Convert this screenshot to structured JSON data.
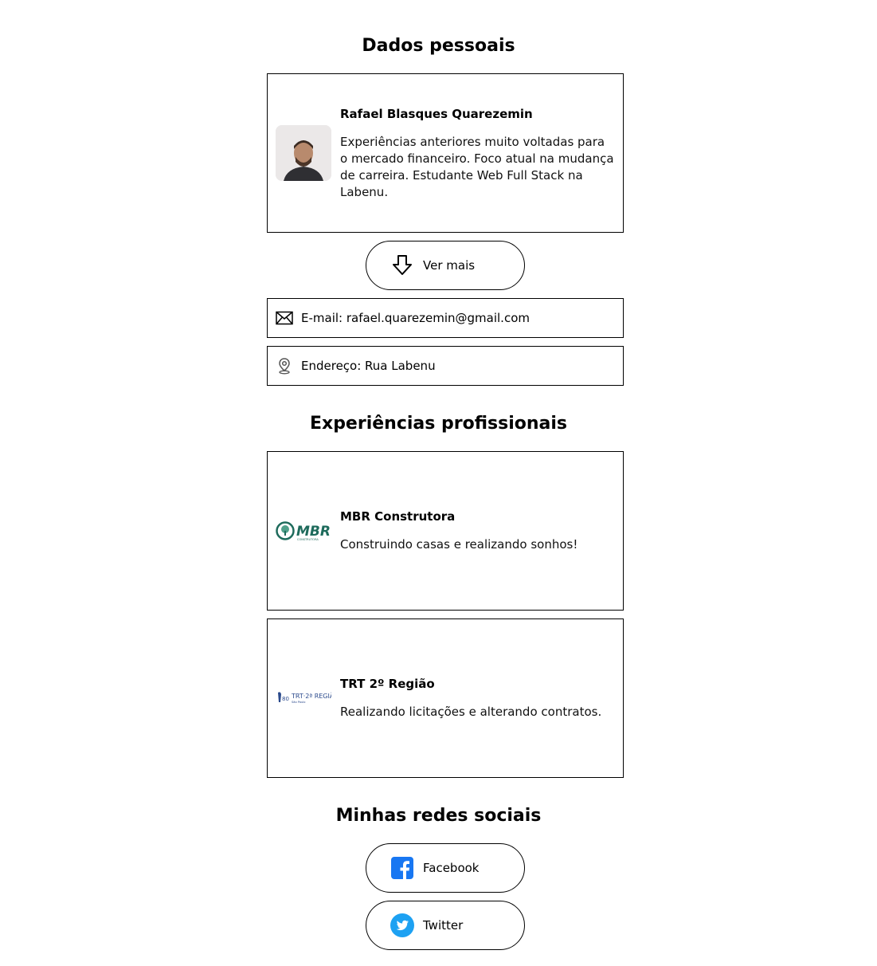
{
  "personal": {
    "title": "Dados pessoais",
    "name": "Rafael Blasques Quarezemin",
    "description": "Experiências anteriores muito voltadas para o mercado financeiro. Foco atual na mudança de carreira. Estudante Web Full Stack na Labenu.",
    "see_more_label": "Ver mais",
    "email_text": "E-mail: rafael.quarezemin@gmail.com",
    "address_text": "Endereço: Rua Labenu"
  },
  "experience": {
    "title": "Experiências profissionais",
    "items": [
      {
        "company": "MBR Construtora",
        "description": "Construindo casas e realizando sonhos!",
        "logo_text": "MBR",
        "logo_sub": "CONSTRUTORA"
      },
      {
        "company": "TRT 2º Região",
        "description": "Realizando licitações e alterando contratos.",
        "logo_text": "TRT·2ª REGIÃO",
        "logo_sub": "São Paulo"
      }
    ]
  },
  "social": {
    "title": "Minhas redes sociais",
    "facebook_label": "Facebook",
    "twitter_label": "Twitter"
  },
  "colors": {
    "facebook": "#1877f2",
    "twitter": "#1da1f2",
    "mbr_green": "#1e6b5c",
    "trt_blue": "#2b4a8c"
  }
}
